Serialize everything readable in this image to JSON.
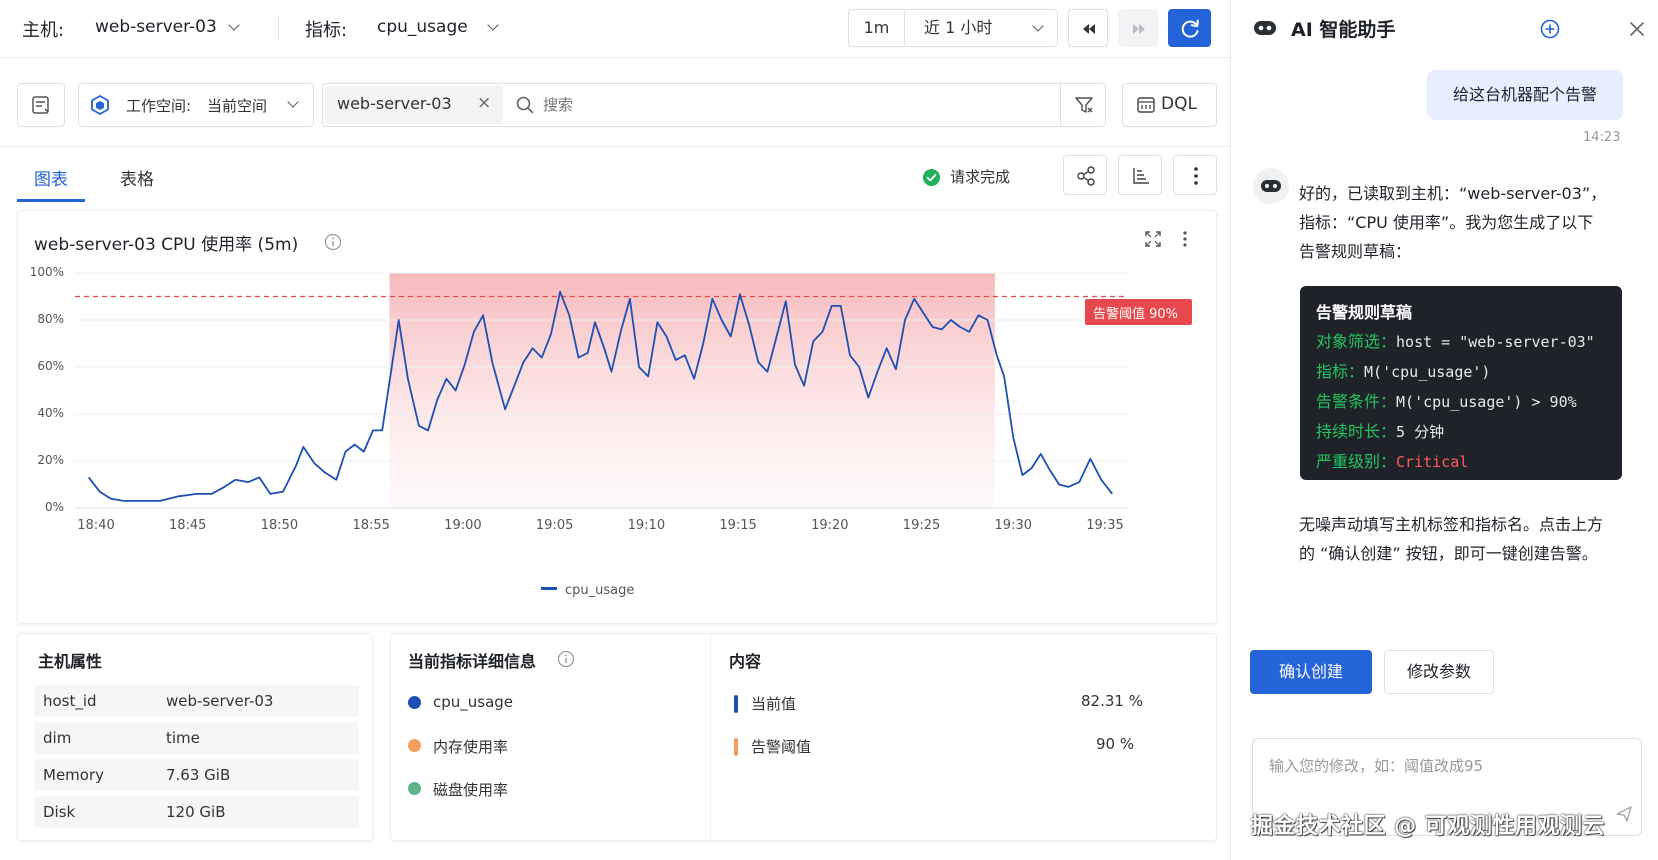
{
  "topbar": {
    "host_label": "主机:",
    "host_value": "web-server-03",
    "metric_label": "指标:",
    "metric_value": "cpu_usage",
    "interval": "1m",
    "time_range": "近 1 小时"
  },
  "filter": {
    "workspace_label": "工作空间:",
    "workspace_value": "当前空间",
    "tag": "web-server-03",
    "search_placeholder": "搜索",
    "dql_label": "DQL"
  },
  "tabs": [
    {
      "label": "图表",
      "active": true
    },
    {
      "label": "表格",
      "active": false
    }
  ],
  "status_text": "请求完成",
  "chart": {
    "title": "web-server-03 CPU 使用率 (5m)",
    "threshold_label": "告警阈值 90%"
  },
  "chart_data": {
    "type": "line",
    "title": "web-server-03 CPU 使用率 (5m)",
    "xlabel": "",
    "ylabel": "",
    "ylim": [
      0,
      100
    ],
    "yticks": [
      "0%",
      "20%",
      "40%",
      "60%",
      "80%",
      "100%"
    ],
    "xticks": [
      "18:40",
      "18:45",
      "18:50",
      "18:55",
      "19:00",
      "19:05",
      "19:10",
      "19:15",
      "19:20",
      "19:25",
      "19:30",
      "19:35"
    ],
    "grid": true,
    "legend": "bottom-center",
    "threshold": 90,
    "alert_window": [
      "18:56",
      "19:29"
    ],
    "series": [
      {
        "name": "cpu_usage",
        "color": "#1f4fb5",
        "points": [
          [
            "18:39.6",
            13
          ],
          [
            "18:40.2",
            7
          ],
          [
            "18:40.8",
            4
          ],
          [
            "18:41.5",
            3
          ],
          [
            "18:42.5",
            3
          ],
          [
            "18:43.5",
            3
          ],
          [
            "18:44.5",
            5
          ],
          [
            "18:45.5",
            6
          ],
          [
            "18:46.3",
            6
          ],
          [
            "18:47",
            9
          ],
          [
            "18:47.6",
            12
          ],
          [
            "18:48.3",
            11
          ],
          [
            "18:48.9",
            13
          ],
          [
            "18:49.5",
            6
          ],
          [
            "18:50.2",
            7
          ],
          [
            "18:50.9",
            18
          ],
          [
            "18:51.3",
            26
          ],
          [
            "18:51.9",
            19
          ],
          [
            "18:52.5",
            15
          ],
          [
            "18:53.1",
            12
          ],
          [
            "18:53.6",
            24
          ],
          [
            "18:54.1",
            27
          ],
          [
            "18:54.6",
            24
          ],
          [
            "18:55.1",
            33
          ],
          [
            "18:55.6",
            33
          ],
          [
            "18:56.1",
            59
          ],
          [
            "18:56.5",
            80
          ],
          [
            "18:57",
            55
          ],
          [
            "18:57.6",
            35
          ],
          [
            "18:58.1",
            33
          ],
          [
            "18:58.6",
            46
          ],
          [
            "18:59.1",
            55
          ],
          [
            "18:59.6",
            50
          ],
          [
            "19:00.1",
            61
          ],
          [
            "19:00.6",
            75
          ],
          [
            "19:01.1",
            82
          ],
          [
            "19:01.6",
            62
          ],
          [
            "19:02.3",
            42
          ],
          [
            "19:02.8",
            52
          ],
          [
            "19:03.3",
            62
          ],
          [
            "19:03.8",
            68
          ],
          [
            "19:04.3",
            64
          ],
          [
            "19:04.8",
            74
          ],
          [
            "19:05.3",
            92
          ],
          [
            "19:05.8",
            82
          ],
          [
            "19:06.3",
            64
          ],
          [
            "19:06.8",
            66
          ],
          [
            "19:07.2",
            79
          ],
          [
            "19:07.7",
            68
          ],
          [
            "19:08.1",
            58
          ],
          [
            "19:08.6",
            75
          ],
          [
            "19:09.1",
            89
          ],
          [
            "19:09.6",
            60
          ],
          [
            "19:10.1",
            56
          ],
          [
            "19:10.6",
            79
          ],
          [
            "19:11.1",
            73
          ],
          [
            "19:11.6",
            63
          ],
          [
            "19:12.1",
            65
          ],
          [
            "19:12.6",
            55
          ],
          [
            "19:13.1",
            70
          ],
          [
            "19:13.6",
            89
          ],
          [
            "19:14.1",
            80
          ],
          [
            "19:14.6",
            73
          ],
          [
            "19:15.1",
            91
          ],
          [
            "19:15.6",
            78
          ],
          [
            "19:16.1",
            62
          ],
          [
            "19:16.6",
            58
          ],
          [
            "19:17.1",
            73
          ],
          [
            "19:17.6",
            88
          ],
          [
            "19:18.1",
            61
          ],
          [
            "19:18.6",
            52
          ],
          [
            "19:19.1",
            71
          ],
          [
            "19:19.6",
            75
          ],
          [
            "19:20.1",
            86
          ],
          [
            "19:20.6",
            86
          ],
          [
            "19:21.1",
            65
          ],
          [
            "19:21.6",
            60
          ],
          [
            "19:22.1",
            47
          ],
          [
            "19:22.6",
            58
          ],
          [
            "19:23.1",
            68
          ],
          [
            "19:23.6",
            59
          ],
          [
            "19:24.1",
            80
          ],
          [
            "19:24.6",
            89
          ],
          [
            "19:25.1",
            83
          ],
          [
            "19:25.6",
            77
          ],
          [
            "19:26.1",
            76
          ],
          [
            "19:26.6",
            80
          ],
          [
            "19:27.1",
            77
          ],
          [
            "19:27.6",
            75
          ],
          [
            "19:28.1",
            82
          ],
          [
            "19:28.6",
            80
          ],
          [
            "19:29.1",
            65
          ],
          [
            "19:29.5",
            56
          ],
          [
            "19:30",
            30
          ],
          [
            "19:30.5",
            14
          ],
          [
            "19:31",
            17
          ],
          [
            "19:31.5",
            23
          ],
          [
            "19:32",
            16
          ],
          [
            "19:32.5",
            10
          ],
          [
            "19:33",
            9
          ],
          [
            "19:33.6",
            11
          ],
          [
            "19:34.2",
            21
          ],
          [
            "19:34.8",
            12
          ],
          [
            "19:35.4",
            6
          ]
        ]
      }
    ]
  },
  "host_attrs": {
    "title": "主机属性",
    "rows": [
      {
        "key": "host_id",
        "value": "web-server-03"
      },
      {
        "key": "dim",
        "value": "time"
      },
      {
        "key": "Memory",
        "value": "7.63 GiB"
      },
      {
        "key": "Disk",
        "value": "120 GiB"
      }
    ]
  },
  "metric_detail": {
    "title": "当前指标详细信息",
    "items": [
      {
        "name": "cpu_usage",
        "color": "#1f4fb5"
      },
      {
        "name": "内存使用率",
        "color": "#f59e5b"
      },
      {
        "name": "磁盘使用率",
        "color": "#5cb58a"
      }
    ]
  },
  "content": {
    "title": "内容",
    "items": [
      {
        "label": "当前值",
        "value": "82.31 %",
        "color": "#1f4fb5"
      },
      {
        "label": "告警阈值",
        "value": "90 %",
        "color": "#f59e5b"
      }
    ]
  },
  "assistant": {
    "title": "AI 智能助手",
    "user_message": "给这台机器配个告警",
    "time": "14:23",
    "reply_lines": [
      "好的，已读取到主机：“web-server-03”，",
      "指标：“CPU 使用率”。我为您生成了以下",
      "告警规则草稿："
    ],
    "draft": {
      "title": "告警规则草稿",
      "rows": [
        {
          "key": "对象筛选：",
          "value": "host = \"web-server-03\""
        },
        {
          "key": "指标：",
          "value": "M('cpu_usage')"
        },
        {
          "key": "告警条件：",
          "value": "M('cpu_usage') > 90%"
        },
        {
          "key": "持续时长：",
          "value": "5 分钟"
        },
        {
          "key": "严重级别：",
          "value": "Critical"
        }
      ]
    },
    "footer_lines": [
      "无噪声动填写主机标签和指标名。点击上方",
      "的 “确认创建” 按钮，即可一键创建告警。"
    ],
    "confirm_label": "确认创建",
    "modify_label": "修改参数",
    "input_placeholder": "输入您的修改，如：阈值改成95",
    "watermark": "掘金技术社区 @ 可观测性用观测云"
  }
}
